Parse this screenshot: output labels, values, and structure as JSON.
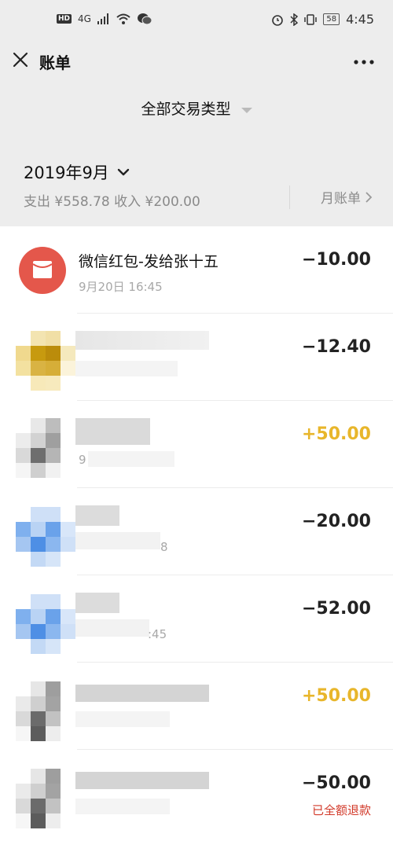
{
  "status_bar": {
    "network": "4G",
    "battery": "58",
    "time": "4:45"
  },
  "header": {
    "title": "账单",
    "more_label": "···"
  },
  "filter": {
    "label": "全部交易类型"
  },
  "month_section": {
    "month": "2019年9月",
    "summary": "支出 ¥558.78 收入 ¥200.00",
    "monthly_bill_label": "月账单"
  },
  "transactions": [
    {
      "title": "微信红包-发给张十五",
      "time": "9月20日 16:45",
      "amount": "−10.00",
      "type": "expense",
      "icon": "red-packet-icon"
    },
    {
      "title": "",
      "time": "",
      "amount": "−12.40",
      "type": "expense",
      "icon": "blurred-avatar"
    },
    {
      "title": "",
      "time": "9",
      "amount": "+50.00",
      "type": "income",
      "icon": "blurred-avatar"
    },
    {
      "title": "",
      "time": "8",
      "amount": "−20.00",
      "type": "expense",
      "icon": "blurred-avatar"
    },
    {
      "title": "",
      "time": ":45",
      "amount": "−52.00",
      "type": "expense",
      "icon": "blurred-avatar"
    },
    {
      "title": "",
      "time": "",
      "amount": "+50.00",
      "type": "income",
      "icon": "blurred-avatar"
    },
    {
      "title": "",
      "time": "",
      "amount": "−50.00",
      "type": "expense",
      "icon": "blurred-avatar",
      "note": "已全额退款"
    }
  ],
  "colors": {
    "income": "#e8b62b",
    "expense": "#222222",
    "refund": "#d23a2a",
    "red_packet": "#e4574b"
  }
}
